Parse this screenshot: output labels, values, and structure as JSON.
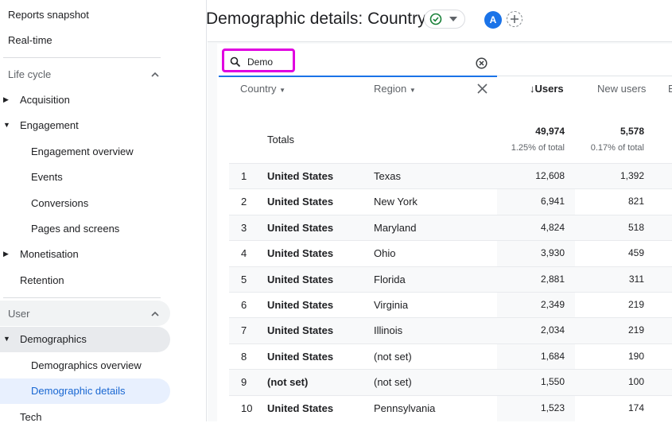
{
  "sidebar": {
    "reports_snapshot": "Reports snapshot",
    "realtime": "Real-time",
    "lifecycle_section": "Life cycle",
    "acquisition": "Acquisition",
    "engagement": "Engagement",
    "engagement_overview": "Engagement overview",
    "events": "Events",
    "conversions": "Conversions",
    "pages_and_screens": "Pages and screens",
    "monetisation": "Monetisation",
    "retention": "Retention",
    "user_section": "User",
    "demographics": "Demographics",
    "demographics_overview": "Demographics overview",
    "demographic_details": "Demographic details",
    "cut_item": "Tech"
  },
  "header": {
    "title": "Demographic details: Country",
    "avatar_letter": "A"
  },
  "search": {
    "value": "Demo"
  },
  "table": {
    "col_country": "Country",
    "col_region": "Region",
    "col_users": "Users",
    "col_new_users": "New users",
    "col_more": "E",
    "totals_label": "Totals",
    "totals_users": "49,974",
    "totals_users_pct": "1.25% of total",
    "totals_new_users": "5,578",
    "totals_new_users_pct": "0.17% of total",
    "rows": [
      {
        "n": "1",
        "country": "United States",
        "region": "Texas",
        "users": "12,608",
        "new_users": "1,392"
      },
      {
        "n": "2",
        "country": "United States",
        "region": "New York",
        "users": "6,941",
        "new_users": "821"
      },
      {
        "n": "3",
        "country": "United States",
        "region": "Maryland",
        "users": "4,824",
        "new_users": "518"
      },
      {
        "n": "4",
        "country": "United States",
        "region": "Ohio",
        "users": "3,930",
        "new_users": "459"
      },
      {
        "n": "5",
        "country": "United States",
        "region": "Florida",
        "users": "2,881",
        "new_users": "311"
      },
      {
        "n": "6",
        "country": "United States",
        "region": "Virginia",
        "users": "2,349",
        "new_users": "219"
      },
      {
        "n": "7",
        "country": "United States",
        "region": "Illinois",
        "users": "2,034",
        "new_users": "219"
      },
      {
        "n": "8",
        "country": "United States",
        "region": "(not set)",
        "users": "1,684",
        "new_users": "190"
      },
      {
        "n": "9",
        "country": "(not set)",
        "region": "(not set)",
        "users": "1,550",
        "new_users": "100"
      },
      {
        "n": "10",
        "country": "United States",
        "region": "Pennsylvania",
        "users": "1,523",
        "new_users": "174"
      }
    ]
  },
  "colors": {
    "accent": "#1a73e8",
    "highlight": "#e000e0",
    "active_bg": "#e8f0fe"
  }
}
